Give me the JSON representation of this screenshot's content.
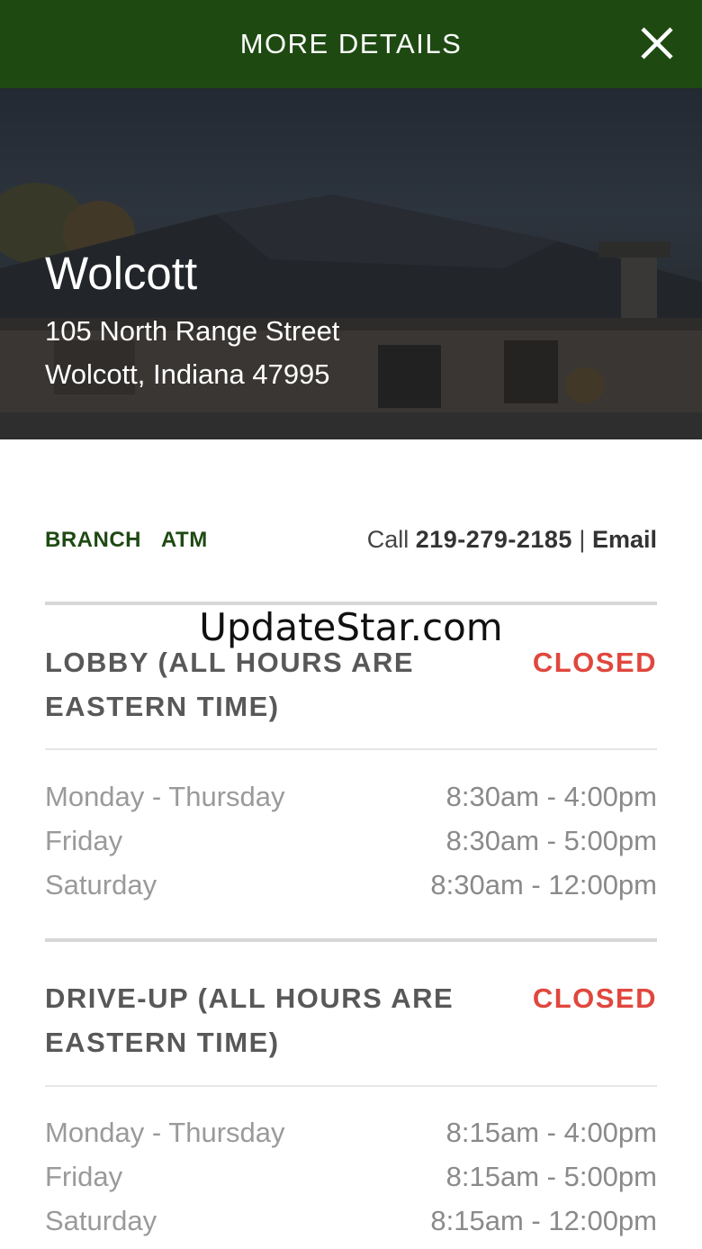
{
  "header": {
    "title": "MORE DETAILS",
    "close_icon": "close-icon"
  },
  "branch": {
    "name": "Wolcott",
    "address_line1": "105 North Range Street",
    "address_line2": "Wolcott, Indiana 47995"
  },
  "tabs": [
    {
      "label": "BRANCH"
    },
    {
      "label": "ATM"
    }
  ],
  "contact": {
    "call_prefix": "Call",
    "phone": "219-279-2185",
    "separator": "|",
    "email_label": "Email"
  },
  "watermark": "UpdateStar.com",
  "sections": [
    {
      "title": "LOBBY (ALL HOURS ARE EASTERN TIME)",
      "status": "CLOSED",
      "rows": [
        {
          "day": "Monday - Thursday",
          "hours": "8:30am - 4:00pm"
        },
        {
          "day": "Friday",
          "hours": "8:30am - 5:00pm"
        },
        {
          "day": "Saturday",
          "hours": "8:30am - 12:00pm"
        }
      ]
    },
    {
      "title": "DRIVE-UP (ALL HOURS ARE EASTERN TIME)",
      "status": "CLOSED",
      "rows": [
        {
          "day": "Monday - Thursday",
          "hours": "8:15am - 4:00pm"
        },
        {
          "day": "Friday",
          "hours": "8:15am - 5:00pm"
        },
        {
          "day": "Saturday",
          "hours": "8:15am - 12:00pm"
        }
      ]
    }
  ],
  "colors": {
    "header_bg": "#1e4a12",
    "status_closed": "#e0473d",
    "tab_text": "#1e4a12"
  }
}
